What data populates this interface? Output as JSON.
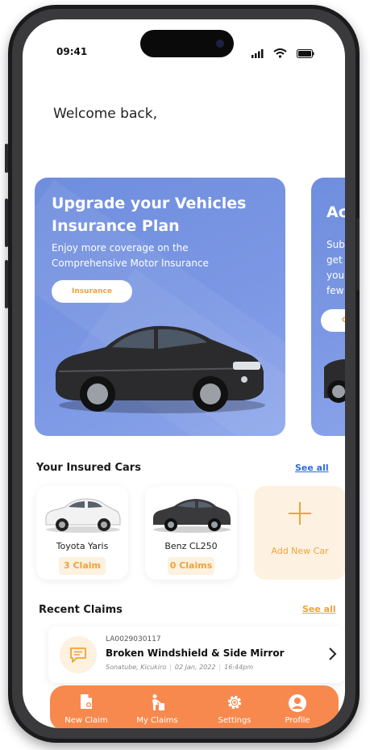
{
  "status_bar": {
    "time": "09:41"
  },
  "welcome": {
    "text": "Welcome back,"
  },
  "promo_main": {
    "title": "Upgrade your Vehicles Insurance Plan",
    "subtitle": "Enjoy more coverage on the Comprehensive Motor Insurance",
    "button_label": "Insurance"
  },
  "promo_second": {
    "title": "Ac",
    "lines": [
      "Subr",
      "get t",
      "your",
      "few"
    ],
    "button_label": "Cl"
  },
  "insured_cars": {
    "title": "Your Insured Cars",
    "see_all": "See all",
    "cars": [
      {
        "name": "Toyota Yaris",
        "claims": "3 Claim",
        "color": "#f2f2f2"
      },
      {
        "name": "Benz CL250",
        "claims": "0 Claims",
        "color": "#3a3a3c"
      }
    ],
    "add_label": "Add New Car"
  },
  "recent_claims": {
    "title": "Recent Claims",
    "see_all": "See all",
    "items": [
      {
        "id": "LA0029030117",
        "title": "Broken Windshield & Side Mirror",
        "location": "Sonatube, Kicukiro",
        "date": "02 Jan, 2022",
        "time": "16:44pm"
      }
    ]
  },
  "tab_bar": {
    "tabs": [
      {
        "label": "New Claim",
        "icon": "new-claim-icon"
      },
      {
        "label": "My Claims",
        "icon": "my-claims-icon"
      },
      {
        "label": "Settings",
        "icon": "gear-icon"
      },
      {
        "label": "Profile",
        "icon": "profile-icon"
      }
    ]
  },
  "colors": {
    "accent": "#f7894e",
    "accent_text": "#f0a23a",
    "promo_blue": "#7b97e4",
    "link_blue": "#2d6cdf"
  }
}
